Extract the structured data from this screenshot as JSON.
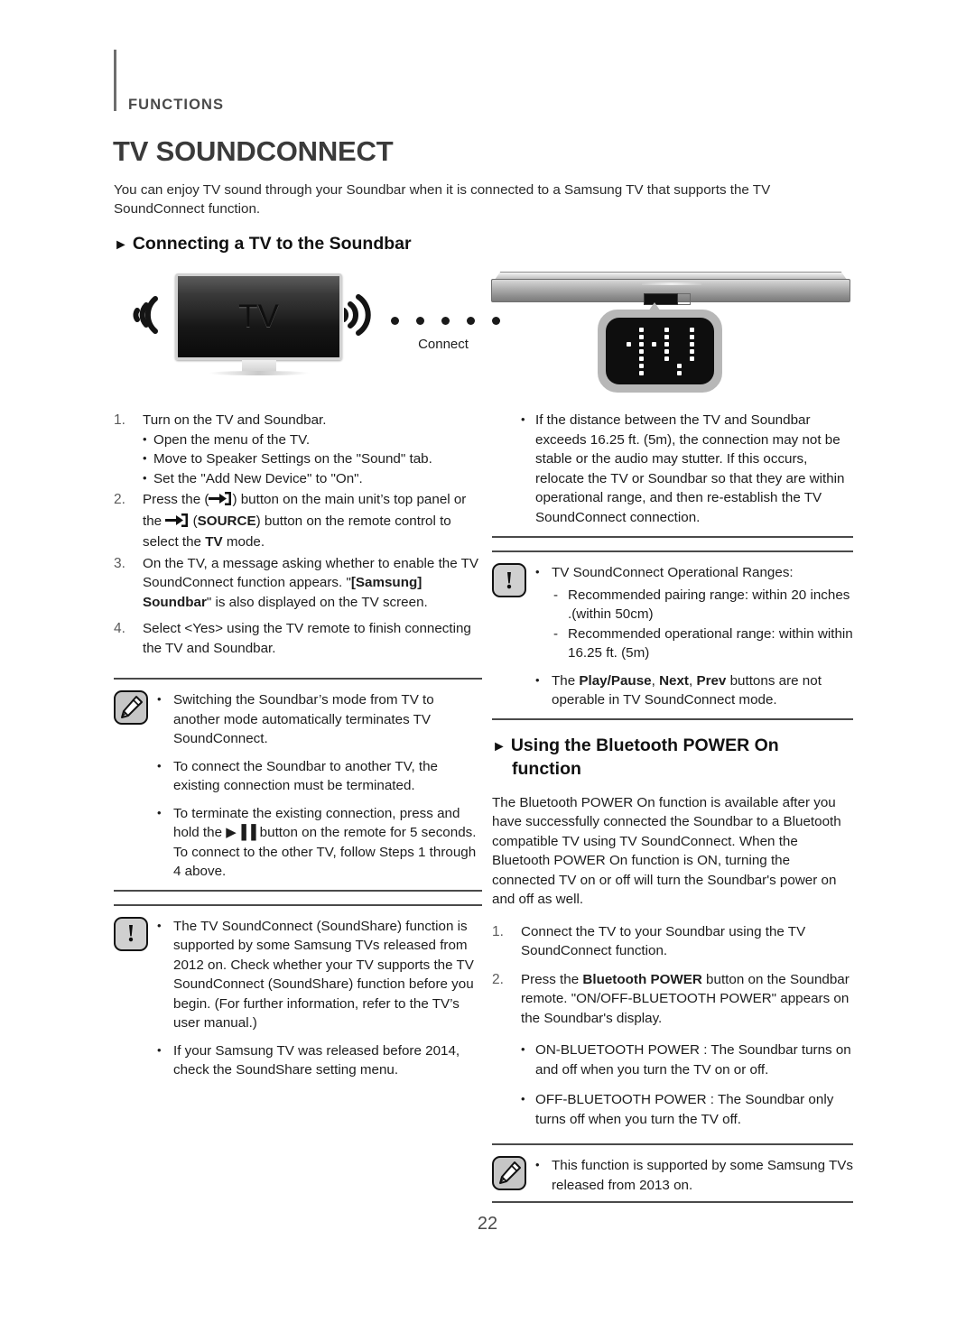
{
  "header": {
    "section_label": "FUNCTIONS",
    "title": "TV SOUNDCONNECT",
    "intro": "You can enjoy TV sound through your Soundbar when it is connected to a Samsung TV that supports the TV SoundConnect function."
  },
  "figures": {
    "tv": {
      "screen_label": "TV",
      "connect_label": "Connect",
      "icon": "tv-wireless-icon"
    },
    "soundbar": {
      "display_text": "TV",
      "icon": "soundbar-icon"
    }
  },
  "sections": {
    "connecting": {
      "heading": "Connecting a TV to the Soundbar",
      "steps": [
        {
          "num": "1.",
          "text": "Turn on the TV and Soundbar.",
          "subitems": [
            "Open the menu of the TV.",
            "Move to Speaker Settings on the \"Sound\" tab.",
            "Set the \"Add New Device\" to \"On\"."
          ]
        },
        {
          "num": "2.",
          "html": "Press the (<span class=\"src-glyph\" data-name=\"source-icon\"></span>) button on the main unit&rsquo;s top panel or the <span class=\"src-glyph\" data-name=\"source-icon\"></span> (<b>SOURCE</b>) button on the remote control to select the <b>TV</b> mode."
        },
        {
          "num": "3.",
          "html": "On the TV, a message asking whether to enable the TV SoundConnect function appears. \"<b>[Samsung] Soundbar</b>\" is also displayed on the TV screen."
        },
        {
          "num": "4.",
          "html": "Select &lt;Yes&gt; using the TV remote to finish connecting the TV and Soundbar."
        }
      ]
    },
    "note_left": {
      "icon": "note-pencil-icon",
      "items": [
        "Switching the Soundbar’s mode from TV to another mode automatically terminates TV SoundConnect.",
        "To connect the Soundbar to another TV, the existing connection must be terminated.",
        "To terminate the existing connection, press and hold the ▶▐▐ button on the remote for 5 seconds. To connect to the other TV, follow Steps 1 through 4 above."
      ]
    },
    "caution_left": {
      "icon": "caution-exclamation-icon",
      "items": [
        "The TV SoundConnect (SoundShare) function is supported by some Samsung TVs released from 2012 on. Check whether your TV supports the TV SoundConnect (SoundShare) function before you begin. (For further information, refer to the TV’s user manual.)",
        "If your Samsung TV was released before 2014, check the SoundShare setting menu."
      ]
    },
    "note_right_top": {
      "items": [
        "If the distance between the TV and Soundbar exceeds 16.25 ft. (5m), the connection may not be stable or the audio may stutter. If this occurs, relocate the TV or Soundbar so that they are within operational range, and then re-establish the TV SoundConnect connection."
      ]
    },
    "caution_right": {
      "icon": "caution-exclamation-icon",
      "item_main": "TV SoundConnect Operational Ranges:",
      "subitems": [
        "Recommended pairing range: within  20 inches .(within 50cm)",
        "Recommended operational range: within within 16.25 ft. (5m)"
      ],
      "item_last_html": "The <b>Play/Pause</b>, <b>Next</b>, <b>Prev</b> buttons are not operable in TV SoundConnect mode."
    },
    "bluetooth_power": {
      "heading_line1": "Using the Bluetooth POWER On",
      "heading_line2": "function",
      "paragraph": "The Bluetooth POWER On function is available after you have successfully connected the Soundbar to a Bluetooth compatible TV using TV SoundConnect. When the Bluetooth POWER On function is ON, turning the connected TV on or off will turn the Soundbar's power on and off as well.",
      "steps": [
        {
          "num": "1.",
          "html": "Connect the TV to your Soundbar using the TV SoundConnect function."
        },
        {
          "num": "2.",
          "html": "Press the <b>Bluetooth POWER</b> button on the Soundbar remote. \"ON/OFF-BLUETOOTH POWER\" appears on the Soundbar's display."
        }
      ],
      "bullets": [
        "ON-BLUETOOTH POWER  : The Soundbar turns on and off when you turn the TV on or off.",
        "OFF-BLUETOOTH POWER  : The Soundbar only turns off when you turn the TV off."
      ]
    },
    "note_right_bottom": {
      "icon": "note-pencil-icon",
      "items": [
        "This function is supported by some Samsung TVs released from 2013 on."
      ]
    }
  },
  "footer": {
    "page_number": "22"
  },
  "colors": {
    "text": "#1d1d1d",
    "heading": "#3a3a3a",
    "rule": "#4a4a4a",
    "icon_fill": "#c6c6c6"
  }
}
